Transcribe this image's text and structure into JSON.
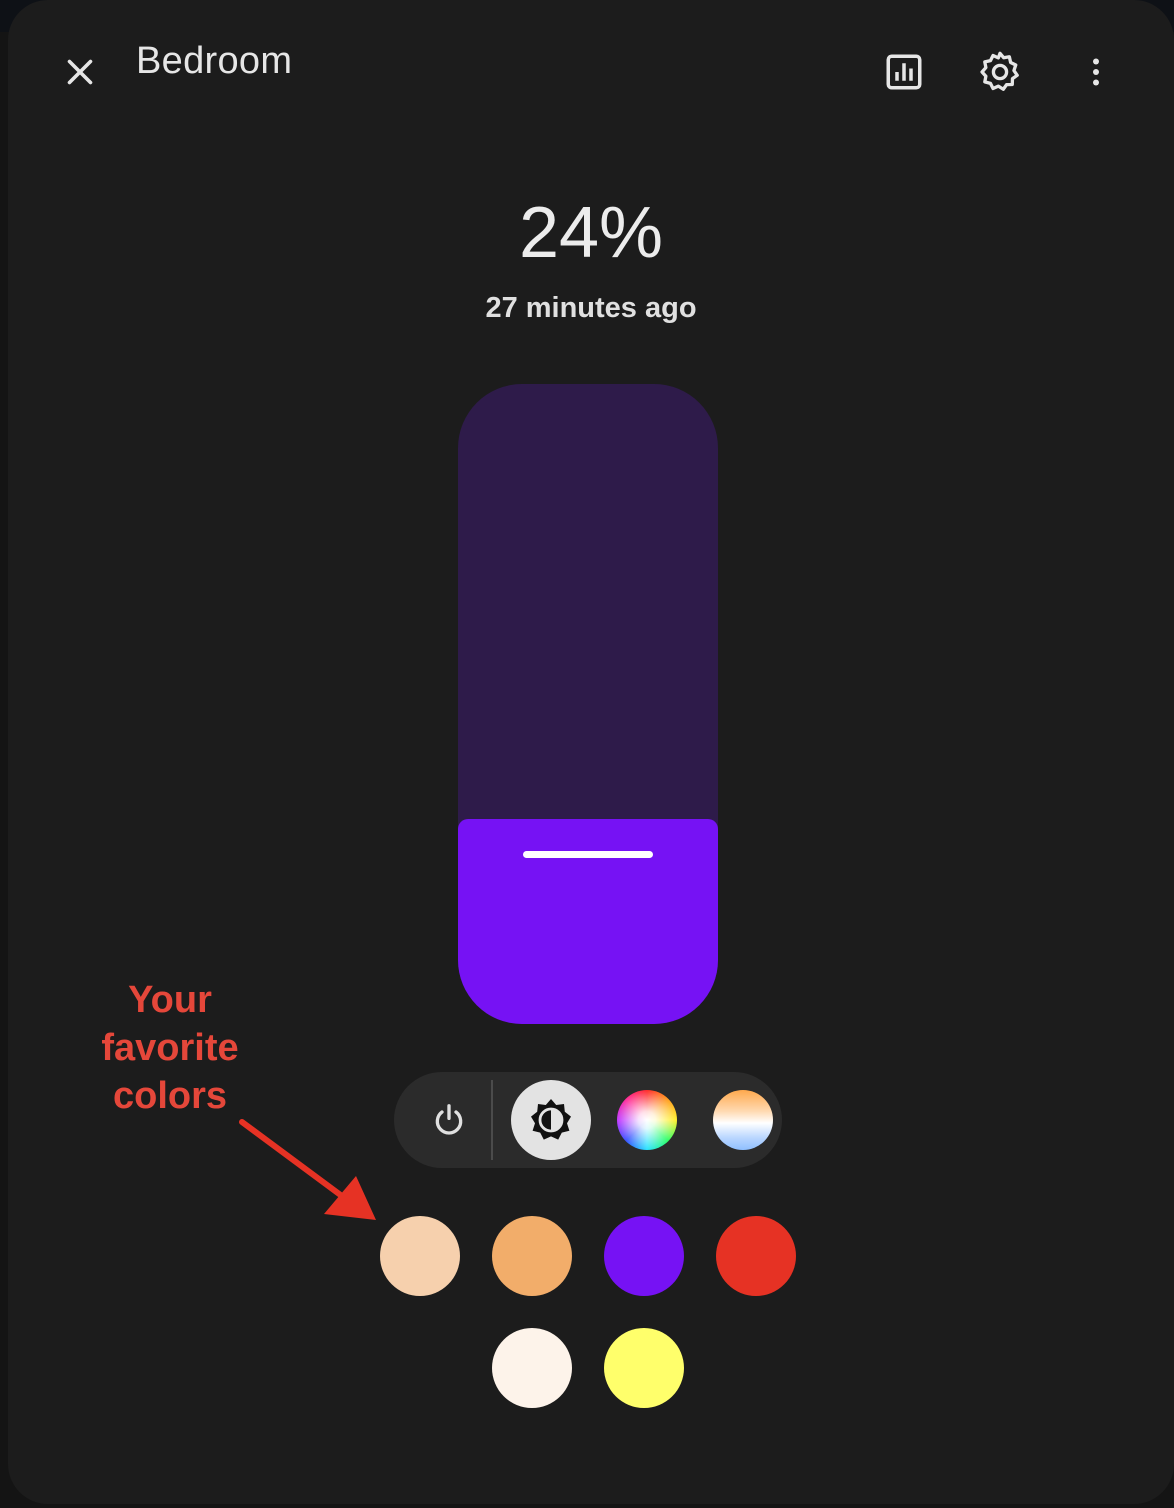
{
  "dialog": {
    "title": "Bedroom",
    "icons": {
      "close": "close-icon",
      "history": "chart-box-icon",
      "settings": "gear-icon",
      "more": "dots-vertical-icon"
    }
  },
  "state": {
    "brightness_text": "24%",
    "brightness_value": 24,
    "last_changed": "27 minutes ago"
  },
  "slider": {
    "track_color": "#2e1b4a",
    "fill_color": "#7612f4"
  },
  "modes": [
    {
      "name": "power",
      "icon": "power-icon",
      "selected": false
    },
    {
      "name": "brightness",
      "icon": "brightness-icon",
      "selected": true
    },
    {
      "name": "color",
      "icon": "color-wheel-icon",
      "selected": false
    },
    {
      "name": "color-temperature",
      "icon": "color-temperature-icon",
      "selected": false
    }
  ],
  "favorite_colors": [
    "#f6d0ad",
    "#f2ad6a",
    "#7612f4",
    "#e63224",
    "#fdf3ea",
    "#ffff6b"
  ],
  "annotation": {
    "line1": "Your",
    "line2": "favorite",
    "line3": "colors",
    "color": "#e5473a"
  }
}
